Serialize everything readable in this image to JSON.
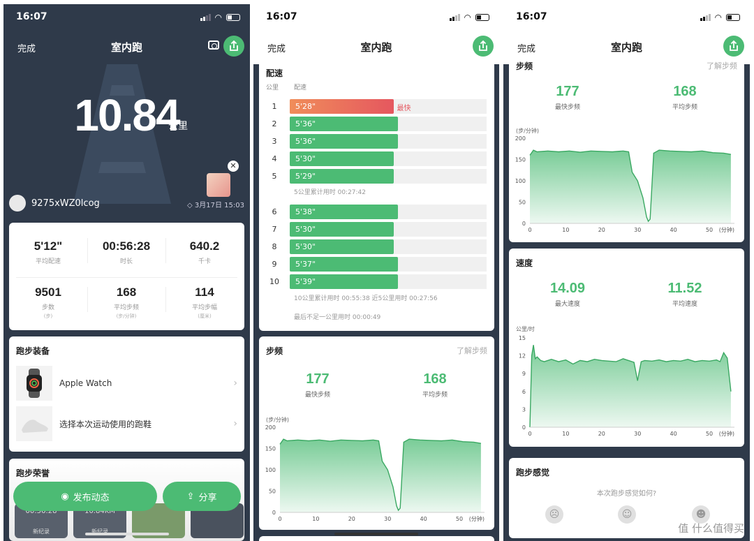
{
  "status": {
    "time": "16:07"
  },
  "nav": {
    "done": "完成",
    "title": "室内跑"
  },
  "hero": {
    "distance": "10.84",
    "unit": "公里"
  },
  "user": {
    "name": "9275xWZ0lcog",
    "date": "3月17日 15:03"
  },
  "stats": [
    {
      "value": "5'12\"",
      "label": "平均配速",
      "sub": ""
    },
    {
      "value": "00:56:28",
      "label": "时长",
      "sub": ""
    },
    {
      "value": "640.2",
      "label": "千卡",
      "sub": ""
    },
    {
      "value": "9501",
      "label": "步数",
      "sub": "(步)"
    },
    {
      "value": "168",
      "label": "平均步频",
      "sub": "(步/分钟)"
    },
    {
      "value": "114",
      "label": "平均步幅",
      "sub": "(厘米)"
    }
  ],
  "equipment": {
    "title": "跑步装备",
    "items": [
      {
        "label": "Apple Watch"
      },
      {
        "label": "选择本次运动使用的跑鞋"
      }
    ]
  },
  "honor": {
    "title": "跑步荣誉",
    "badges": [
      {
        "value": "00:56:28",
        "tag": "新纪录"
      },
      {
        "value": "10.84KM",
        "tag": "新纪录"
      }
    ]
  },
  "actions": {
    "post": "发布动态",
    "share": "分享"
  },
  "pace": {
    "title": "配速",
    "col_km": "公里",
    "col_pace": "配速",
    "fastest_tag": "最快",
    "rows": [
      {
        "km": "1",
        "pace": "5'28\"",
        "fill": 0.53,
        "fastest": true
      },
      {
        "km": "2",
        "pace": "5'36\"",
        "fill": 0.55
      },
      {
        "km": "3",
        "pace": "5'36\"",
        "fill": 0.55
      },
      {
        "km": "4",
        "pace": "5'30\"",
        "fill": 0.53
      },
      {
        "km": "5",
        "pace": "5'29\"",
        "fill": 0.53
      },
      {
        "km": "6",
        "pace": "5'38\"",
        "fill": 0.55
      },
      {
        "km": "7",
        "pace": "5'30\"",
        "fill": 0.53
      },
      {
        "km": "8",
        "pace": "5'30\"",
        "fill": 0.53
      },
      {
        "km": "9",
        "pace": "5'37\"",
        "fill": 0.55
      },
      {
        "km": "10",
        "pace": "5'39\"",
        "fill": 0.55
      }
    ],
    "note5": "5公里累计用时 00:27:42",
    "note10": "10公里累计用时 00:55:38   近5公里用时 00:27:56",
    "note_last": "最后不足一公里用时 00:00:49"
  },
  "cadence": {
    "title": "步频",
    "link": "了解步频",
    "max_value": "177",
    "max_label": "最快步频",
    "avg_value": "168",
    "avg_label": "平均步频",
    "unit": "(步/分钟)",
    "x_suffix": "(分钟)"
  },
  "speed": {
    "title": "速度",
    "max_value": "14.09",
    "max_label": "最大速度",
    "avg_value": "11.52",
    "avg_label": "平均速度",
    "unit": "公里/时",
    "x_suffix": "(分钟)"
  },
  "feeling": {
    "title": "跑步感觉",
    "question": "本次跑步感觉如何?"
  },
  "watermark": "值 什么值得买",
  "chart_data": [
    {
      "type": "area",
      "title": "步频",
      "ylabel": "(步/分钟)",
      "xlabel": "(分钟)",
      "ylim": [
        0,
        200
      ],
      "xlim": [
        0,
        57
      ],
      "yticks": [
        0,
        50,
        100,
        150,
        200
      ],
      "xticks": [
        0,
        10,
        20,
        30,
        40,
        50
      ],
      "x": [
        0,
        1,
        2,
        5,
        8,
        11,
        14,
        17,
        20,
        23,
        26,
        27.5,
        28.5,
        30,
        31.5,
        32.5,
        33,
        33.5,
        34.5,
        36,
        39,
        42,
        45,
        48,
        51,
        54,
        56
      ],
      "y": [
        160,
        172,
        168,
        170,
        168,
        170,
        167,
        170,
        169,
        168,
        170,
        168,
        120,
        100,
        60,
        15,
        5,
        10,
        165,
        172,
        170,
        169,
        168,
        170,
        166,
        165,
        162
      ]
    },
    {
      "type": "area",
      "title": "速度",
      "ylabel": "公里/时",
      "xlabel": "(分钟)",
      "ylim": [
        0,
        15
      ],
      "xlim": [
        0,
        57
      ],
      "yticks": [
        0,
        3,
        6,
        9,
        12,
        15
      ],
      "xticks": [
        0,
        10,
        20,
        30,
        40,
        50
      ],
      "x": [
        0,
        0.5,
        1,
        1.5,
        2,
        3,
        4,
        6,
        8,
        10,
        12,
        14,
        16,
        18,
        20,
        22,
        24,
        26,
        28,
        29,
        30,
        31,
        32,
        34,
        36,
        38,
        40,
        42,
        44,
        46,
        48,
        50,
        52,
        53,
        54,
        55,
        56
      ],
      "y": [
        0,
        12,
        13.8,
        11.5,
        11.8,
        11.2,
        11.0,
        11.4,
        11.0,
        11.3,
        10.6,
        11.2,
        11.0,
        11.4,
        11.2,
        11.1,
        11.0,
        11.5,
        11.1,
        10.9,
        7.8,
        11.0,
        11.2,
        11.1,
        11.3,
        11.0,
        11.2,
        11.1,
        11.4,
        11.0,
        11.2,
        11.1,
        11.3,
        11.0,
        12.5,
        11.6,
        6.0
      ]
    }
  ]
}
